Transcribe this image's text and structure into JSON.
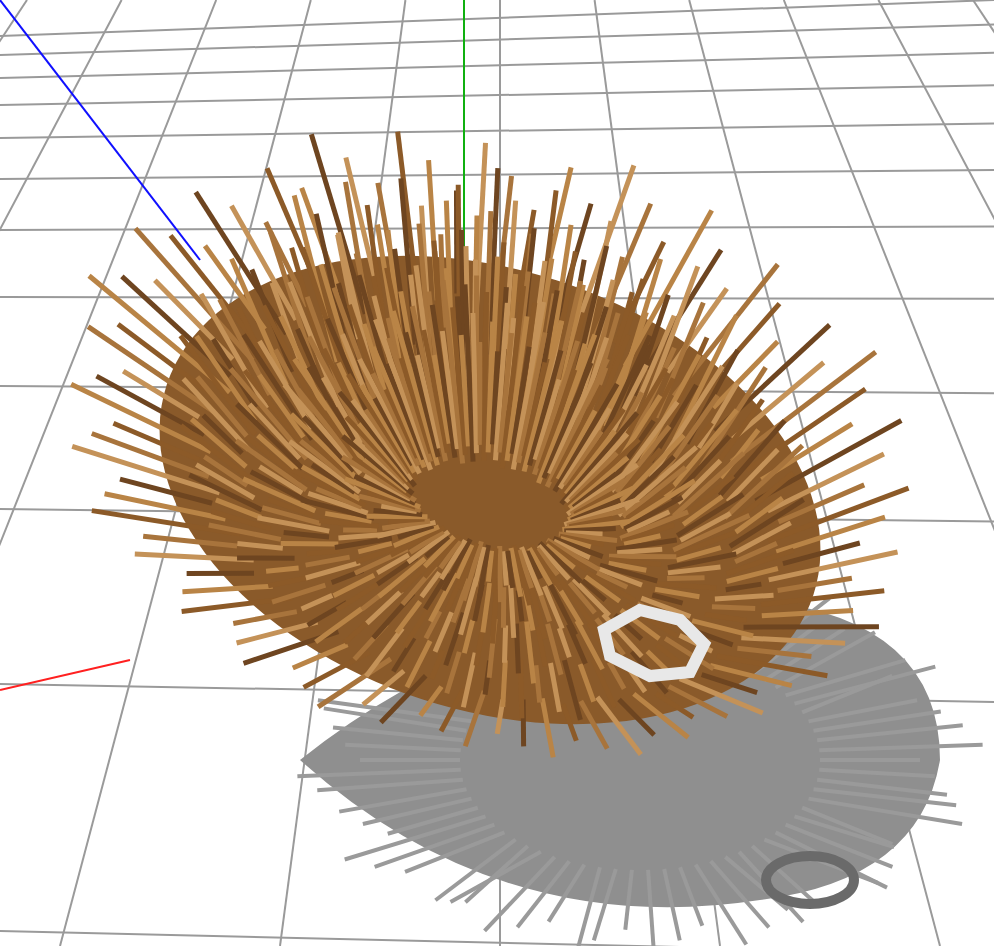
{
  "viewport": {
    "grid": true,
    "axes": true,
    "shadow": true
  }
}
